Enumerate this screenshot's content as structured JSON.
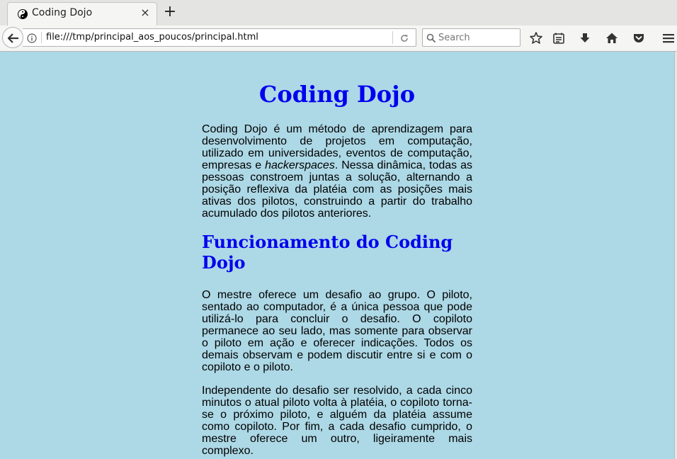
{
  "browser": {
    "tab": {
      "title": "Coding Dojo",
      "close_glyph": "×",
      "favicon": "yin-yang-icon"
    },
    "new_tab_glyph": "+",
    "url": "file:///tmp/principal_aos_poucos/principal.html",
    "search_placeholder": "Search",
    "toolbar_icons": [
      "star-icon",
      "reading-list-icon",
      "download-icon",
      "home-icon",
      "pocket-icon",
      "menu-icon"
    ]
  },
  "page": {
    "background": "#add8e6",
    "heading_color": "#0000ee",
    "title": "Coding Dojo",
    "intro": {
      "before_em": "Coding Dojo é um método de aprendizagem para desenvolvimento de projetos em computação, utilizado em universidades, eventos de computação, empresas e ",
      "em": "hackerspaces",
      "after_em": ". Nessa dinâmica, todas as pessoas constroem juntas a solução, alternando a posição reflexiva da platéia com as posições mais ativas dos pilotos, construindo a partir do trabalho acumulado dos pilotos anteriores."
    },
    "section_title": "Funcionamento do Coding Dojo",
    "paragraph_1": "O mestre oferece um desafio ao grupo. O piloto, sentado ao computador, é a única pessoa que pode utilizá-lo para concluir o desafio. O copiloto permanece ao seu lado, mas somente para observar o piloto em ação e oferecer indicações. Todos os demais observam e podem discutir entre si e com o copiloto e o piloto.",
    "paragraph_2": "Independente do desafio ser resolvido, a cada cinco minutos o atual piloto volta à platéia, o copiloto torna-se o próximo piloto, e alguém da platéia assume como copiloto. Por fim, a cada desafio cumprido, o mestre oferece um outro, ligeiramente mais complexo."
  }
}
